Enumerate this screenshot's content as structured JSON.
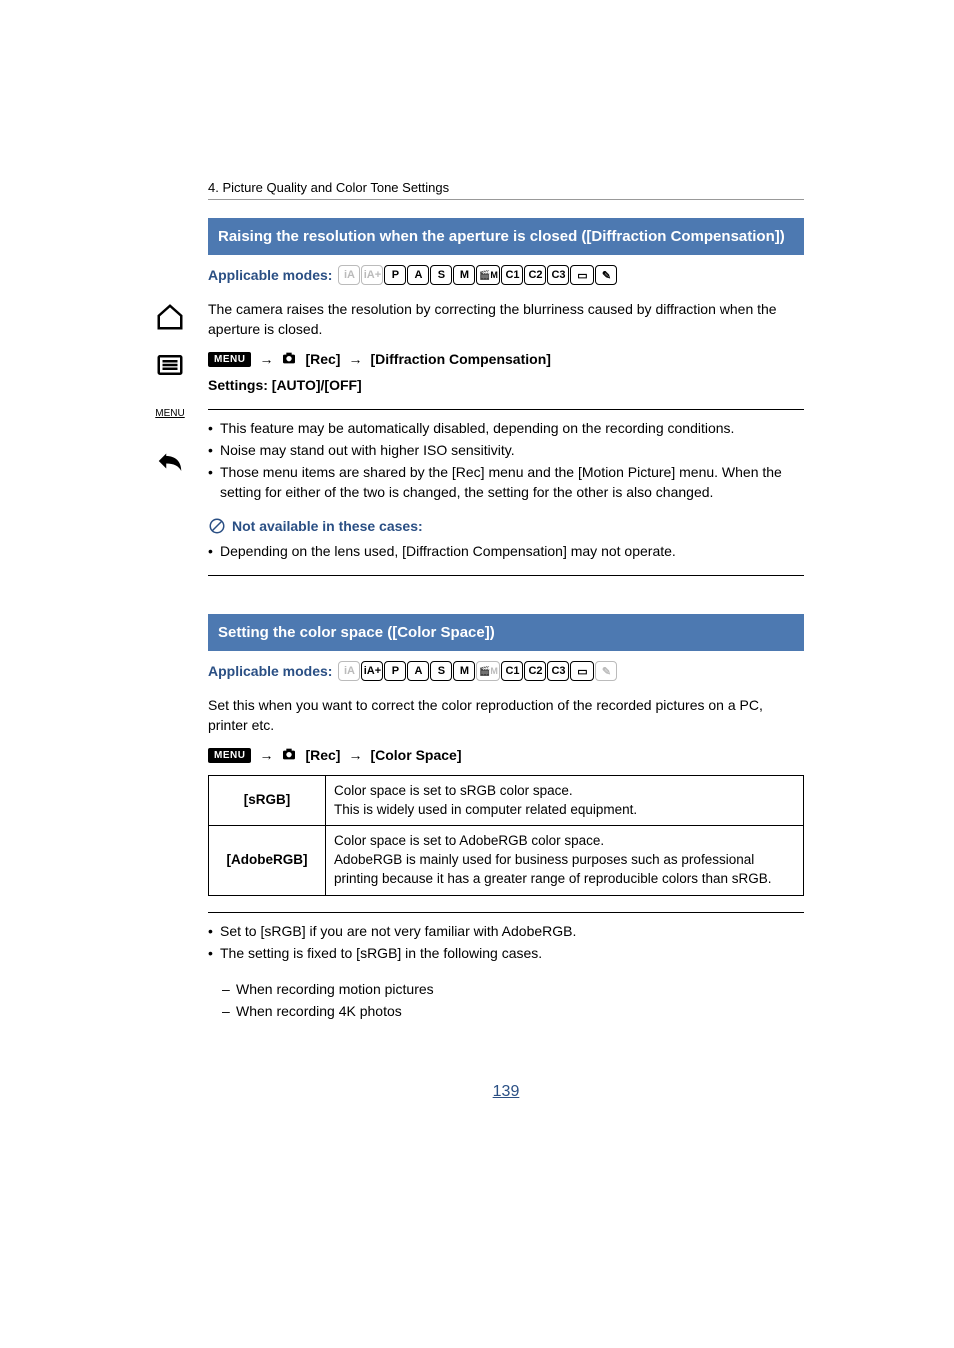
{
  "breadcrumb": "4. Picture Quality and Color Tone Settings",
  "section1": {
    "title": "Raising the resolution when the aperture is closed ([Diffraction Compensation])",
    "applicable_label": "Applicable modes:",
    "modes": [
      {
        "label": "iA",
        "dim": true
      },
      {
        "label": "iA+",
        "dim": true
      },
      {
        "label": "P",
        "dim": false
      },
      {
        "label": "A",
        "dim": false
      },
      {
        "label": "S",
        "dim": false
      },
      {
        "label": "M",
        "dim": false
      },
      {
        "label": "🎬M",
        "dim": false,
        "cls": "movie"
      },
      {
        "label": "C1",
        "dim": false
      },
      {
        "label": "C2",
        "dim": false
      },
      {
        "label": "C3",
        "dim": false
      },
      {
        "label": "▭",
        "dim": false,
        "cls": "pan"
      },
      {
        "label": "✎",
        "dim": false
      }
    ],
    "intro": "The camera raises the resolution by correcting the blurriness caused by diffraction when the aperture is closed.",
    "menu_label": "MENU",
    "rec_label": "[Rec]",
    "item_label": "[Diffraction Compensation]",
    "settings_label": "Settings: [AUTO]/[OFF]",
    "bullets": [
      "This feature may be automatically disabled, depending on the recording conditions.",
      "Noise may stand out with higher ISO sensitivity.",
      "Those menu items are shared by the [Rec] menu and the [Motion Picture] menu. When the setting for either of the two is changed, the setting for the other is also changed."
    ],
    "na_title": "Not available in these cases:",
    "na_bullets": [
      "Depending on the lens used, [Diffraction Compensation] may not operate."
    ]
  },
  "section2": {
    "title": "Setting the color space ([Color Space])",
    "applicable_label": "Applicable modes:",
    "modes": [
      {
        "label": "iA",
        "dim": true
      },
      {
        "label": "iA+",
        "dim": false
      },
      {
        "label": "P",
        "dim": false
      },
      {
        "label": "A",
        "dim": false
      },
      {
        "label": "S",
        "dim": false
      },
      {
        "label": "M",
        "dim": false
      },
      {
        "label": "🎬M",
        "dim": true,
        "cls": "movie"
      },
      {
        "label": "C1",
        "dim": false
      },
      {
        "label": "C2",
        "dim": false
      },
      {
        "label": "C3",
        "dim": false
      },
      {
        "label": "▭",
        "dim": false,
        "cls": "pan"
      },
      {
        "label": "✎",
        "dim": true
      }
    ],
    "intro": "Set this when you want to correct the color reproduction of the recorded pictures on a PC, printer etc.",
    "menu_label": "MENU",
    "rec_label": "[Rec]",
    "item_label": "[Color Space]",
    "table": [
      {
        "name": "[sRGB]",
        "desc": "Color space is set to sRGB color space.\nThis is widely used in computer related equipment."
      },
      {
        "name": "[AdobeRGB]",
        "desc": "Color space is set to AdobeRGB color space.\nAdobeRGB is mainly used for business purposes such as professional printing because it has a greater range of reproducible colors than sRGB."
      }
    ],
    "bullets": [
      "Set to [sRGB] if you are not very familiar with AdobeRGB.",
      "The setting is fixed to [sRGB] in the following cases."
    ],
    "dashes": [
      "When recording motion pictures",
      "When recording 4K photos"
    ]
  },
  "page_number": "139"
}
